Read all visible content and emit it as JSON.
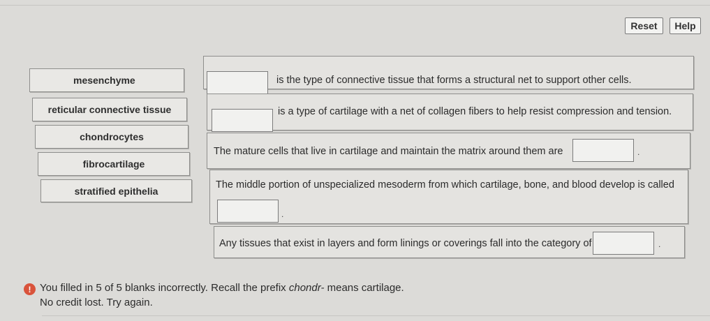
{
  "toolbar": {
    "reset_label": "Reset",
    "help_label": "Help"
  },
  "terms": [
    "mesenchyme",
    "reticular connective tissue",
    "chondrocytes",
    "fibrocartilage",
    "stratified epithelia"
  ],
  "questions": [
    {
      "text": "is the type of connective tissue that forms a structural net to support other cells."
    },
    {
      "text": "is a type of cartilage with a net of collagen fibers to help resist compression and tension."
    },
    {
      "text": "The mature cells that live in cartilage and maintain the matrix around them are",
      "suffix": "."
    },
    {
      "text": "The middle portion of unspecialized mesoderm from which cartilage, bone, and blood develop is called",
      "suffix": "."
    },
    {
      "text": "Any tissues that exist in layers and form linings or coverings fall into the category of",
      "suffix": "."
    }
  ],
  "feedback": {
    "prefix": "You filled in 5 of 5 blanks incorrectly. Recall the prefix ",
    "term": "chondr-",
    "suffix": " means cartilage.",
    "line2": "No credit lost. Try again.",
    "icon": "alert-icon",
    "icon_glyph": "!"
  }
}
